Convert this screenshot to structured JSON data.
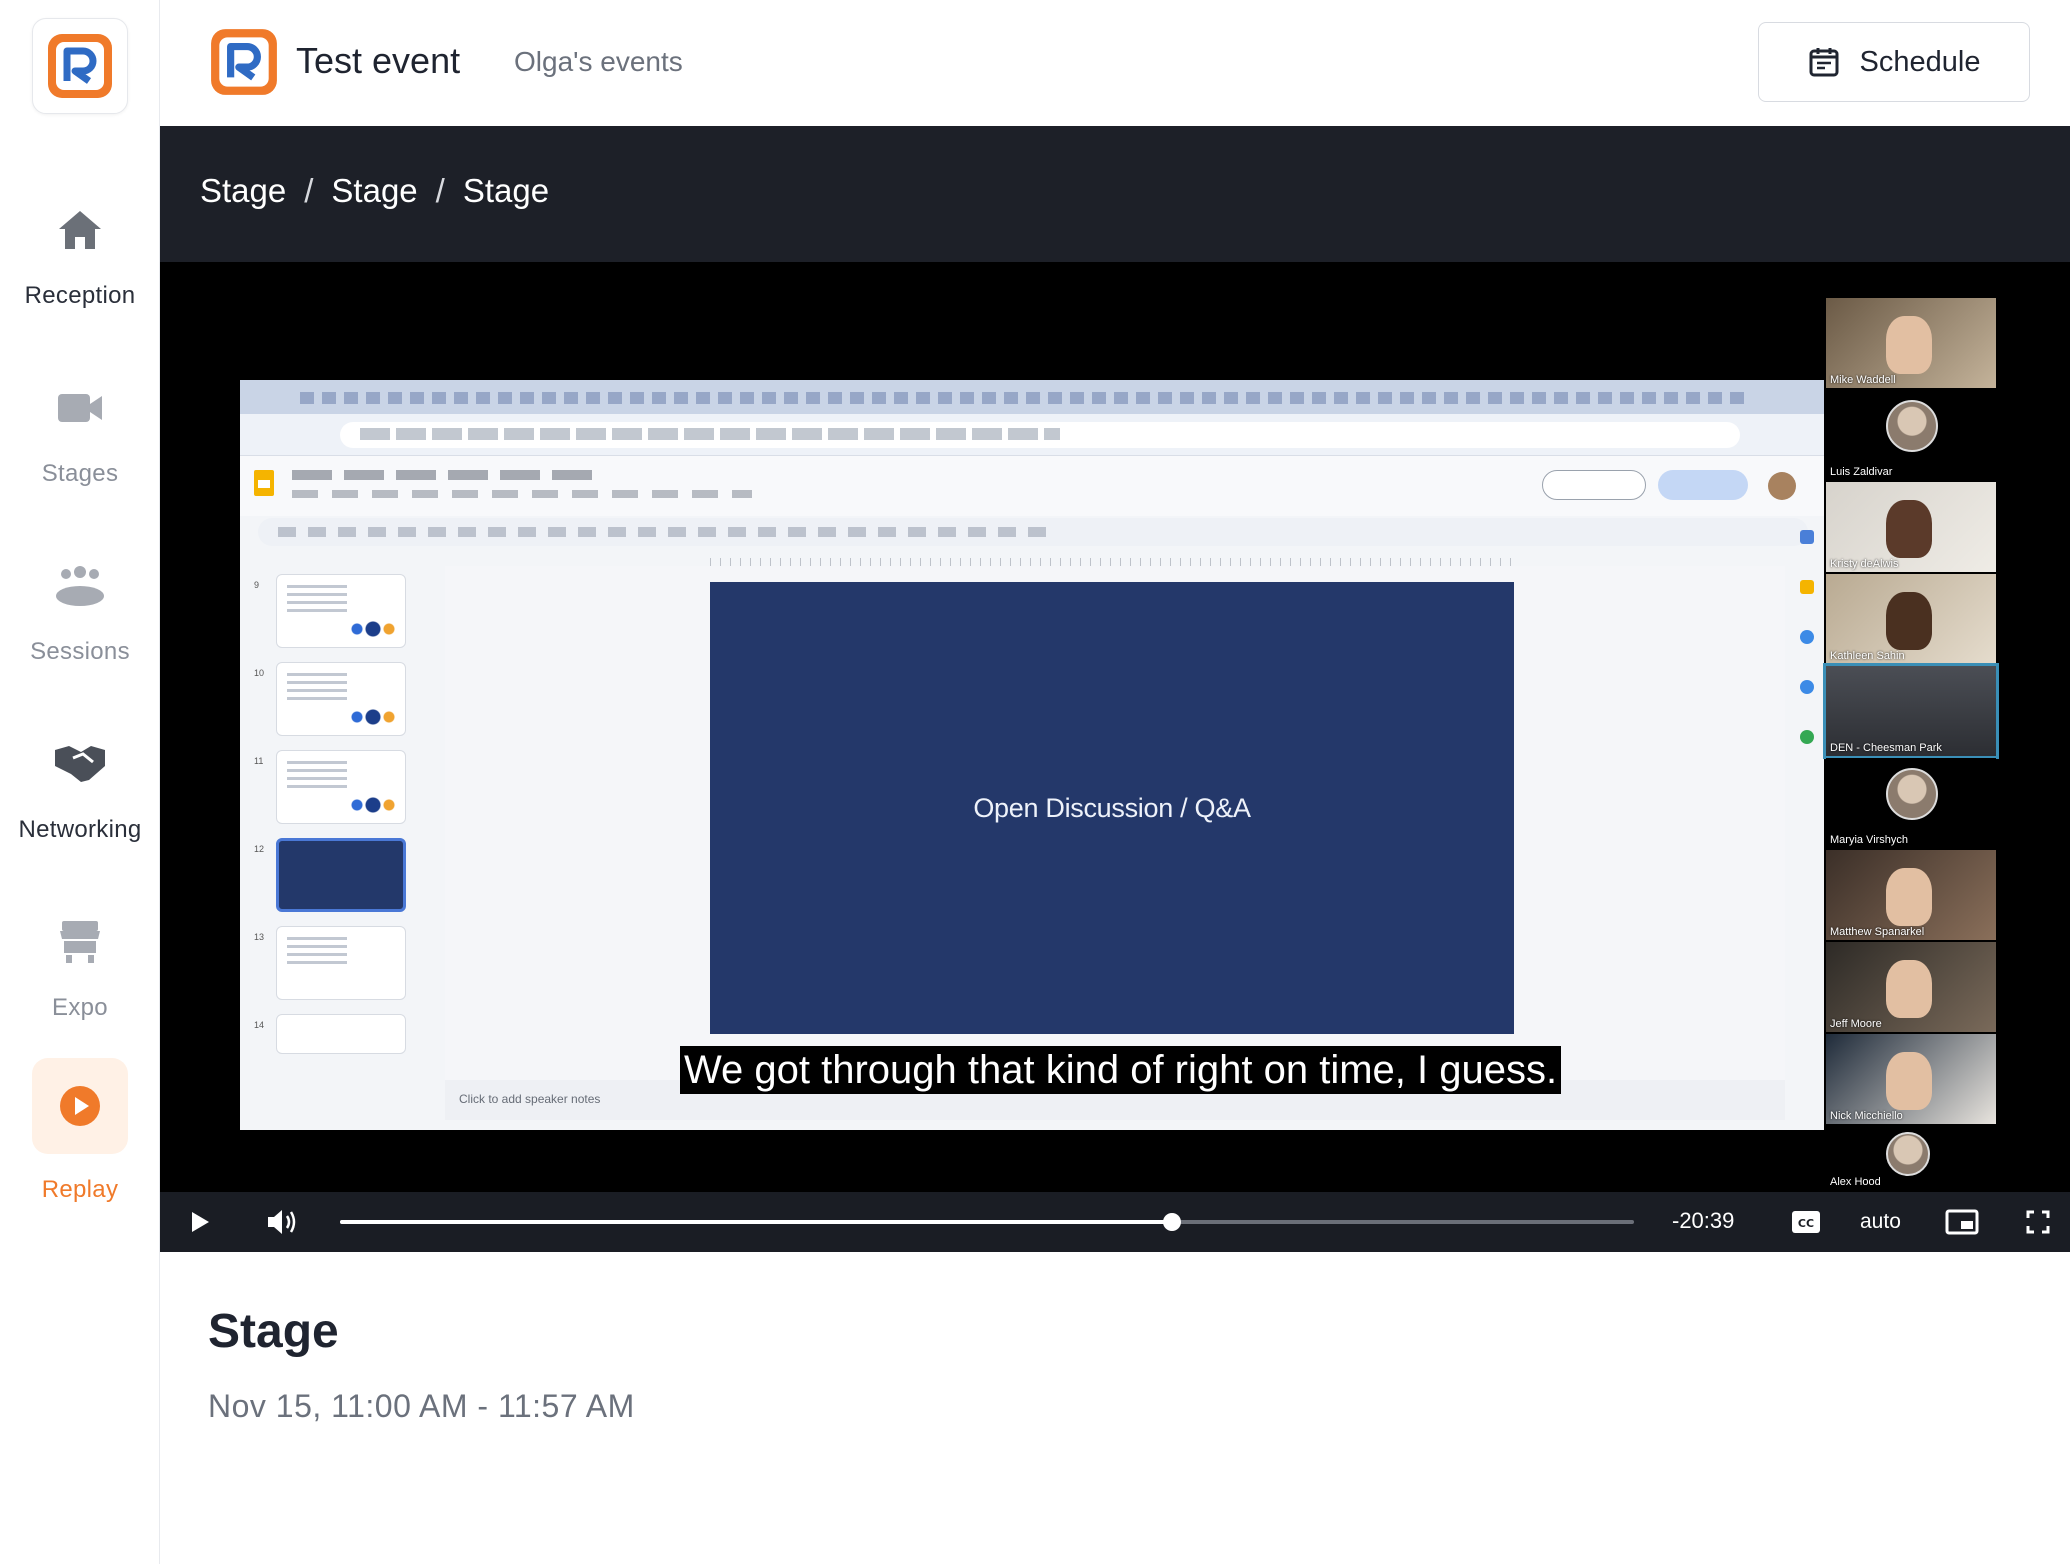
{
  "sidebar": {
    "items": [
      {
        "label": "Reception",
        "icon": "home-icon"
      },
      {
        "label": "Stages",
        "icon": "video-camera-icon"
      },
      {
        "label": "Sessions",
        "icon": "people-group-icon"
      },
      {
        "label": "Networking",
        "icon": "handshake-icon"
      },
      {
        "label": "Expo",
        "icon": "storefront-icon"
      },
      {
        "label": "Replay",
        "icon": "play-circle-icon"
      }
    ],
    "active": "Replay",
    "accent_color": "#f07a2a"
  },
  "header": {
    "event_title": "Test event",
    "organizer": "Olga's events",
    "schedule_label": "Schedule"
  },
  "breadcrumb": [
    "Stage",
    "Stage",
    "Stage"
  ],
  "video": {
    "slide_text": "Open Discussion / Q&A",
    "speaker_notes_placeholder": "Click to add speaker notes",
    "caption": "We got through that kind of right on time, I guess.",
    "time_remaining": "-20:39",
    "quality": "auto",
    "progress_fraction": 0.643,
    "thumb_numbers": [
      "9",
      "10",
      "11",
      "12",
      "13",
      "14"
    ],
    "participants": [
      "Mike Waddell",
      "Luis Zaldivar",
      "Kristy deAlwis",
      "Kathleen Sahin",
      "DEN - Cheesman Park",
      "Maryia Virshych",
      "Matthew Spanarkel",
      "Jeff Moore",
      "Nick Micchiello",
      "Alex Hood"
    ]
  },
  "session": {
    "title": "Stage",
    "time": "Nov 15, 11:00 AM - 11:57 AM"
  }
}
